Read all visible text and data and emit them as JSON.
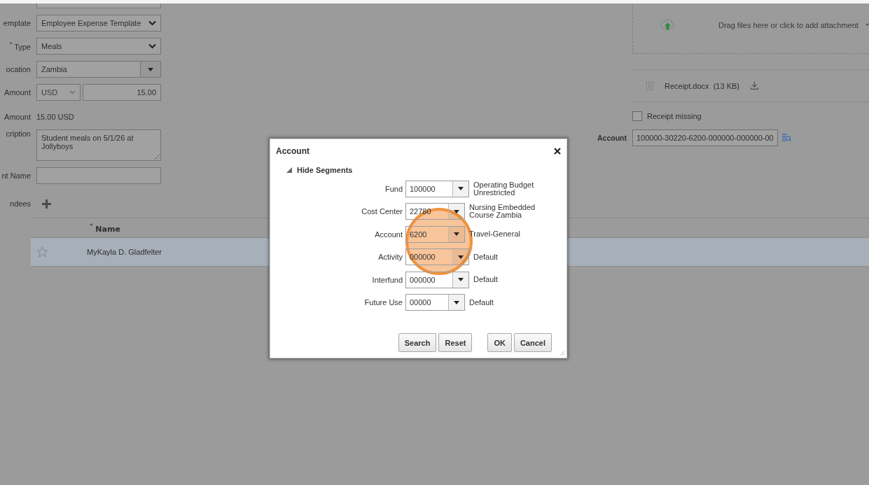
{
  "form": {
    "fields": [
      {
        "label": "emplate",
        "kind": "select",
        "value": "Employee Expense Template"
      },
      {
        "label": "$^{*}$ Type",
        "kind": "select",
        "value": "Meals"
      },
      {
        "label": "ocation",
        "kind": "lov",
        "value": "Zambia"
      },
      {
        "label": "Amount",
        "kind": "amount",
        "currency": "USD",
        "value": "15.00"
      },
      {
        "label": "Amount",
        "kind": "text",
        "value": "15.00 USD"
      },
      {
        "label": "cription",
        "kind": "textarea",
        "value": "Student meals on 5/1/26 at Jollyboys"
      },
      {
        "label": "nt Name",
        "kind": "input"
      }
    ]
  },
  "attendees": {
    "label": "ndees",
    "columns": [
      {
        "label": "$^{*}$ Name"
      }
    ],
    "rows": [
      {
        "name": "MyKayla D. Gladfelter",
        "selected": true
      }
    ]
  },
  "attachments": {
    "upload_text": "Drag files here or click to add attachment",
    "files": [
      {
        "name": "Receipt.docx",
        "size": "(13 KB)"
      }
    ]
  },
  "receipt_missing": {
    "label": "Receipt missing",
    "checked": false
  },
  "account": {
    "label": "Account",
    "value": "100000-30220-6200-000000-000000-00"
  },
  "dialog": {
    "title": "Account",
    "toggle": "Hide Segments",
    "expanded": true,
    "segments": [
      {
        "label": "Fund",
        "value": "100000",
        "description": "Operating Budget Unrestricted"
      },
      {
        "label": "Cost Center",
        "value": "22780",
        "description": "Nursing Embedded Course Zambia"
      },
      {
        "label": "Account",
        "value": "6200",
        "description": "Travel-General"
      },
      {
        "label": "Activity",
        "value": "000000",
        "description": "Default"
      },
      {
        "label": "Interfund",
        "value": "000000",
        "description": "Default"
      },
      {
        "label": "Future Use",
        "value": "00000",
        "description": "Default"
      }
    ],
    "buttons": [
      "Search",
      "Reset",
      "OK",
      "Cancel"
    ]
  }
}
